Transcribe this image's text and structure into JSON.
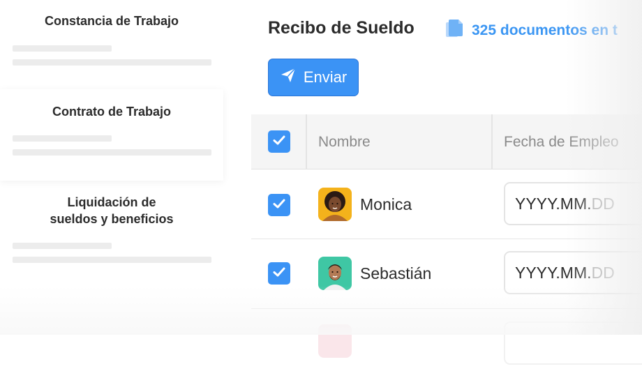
{
  "documents": [
    {
      "title": "Constancia de Trabajo"
    },
    {
      "title": "Contrato de Trabajo"
    },
    {
      "title_line1": "Liquidación de",
      "title_line2": "sueldos y beneficios"
    }
  ],
  "panel": {
    "title": "Recibo de Sueldo",
    "doc_count": "325 documentos en t",
    "send_label": "Enviar"
  },
  "table": {
    "header_checked": true,
    "columns": [
      "Nombre",
      "Fecha de Empleo"
    ],
    "rows": [
      {
        "name": "Monica",
        "checked": true,
        "date_placeholder_main": "YYYY.MM.",
        "date_placeholder_dim": "DD"
      },
      {
        "name": "Sebastián",
        "checked": true,
        "date_placeholder_main": "YYYY.MM.",
        "date_placeholder_dim": "DD"
      }
    ]
  },
  "colors": {
    "accent": "#3b93f5",
    "accent_text": "#3b96f3"
  },
  "icons": {
    "send": "paper-plane-icon",
    "documents": "documents-icon",
    "check": "check-icon"
  }
}
